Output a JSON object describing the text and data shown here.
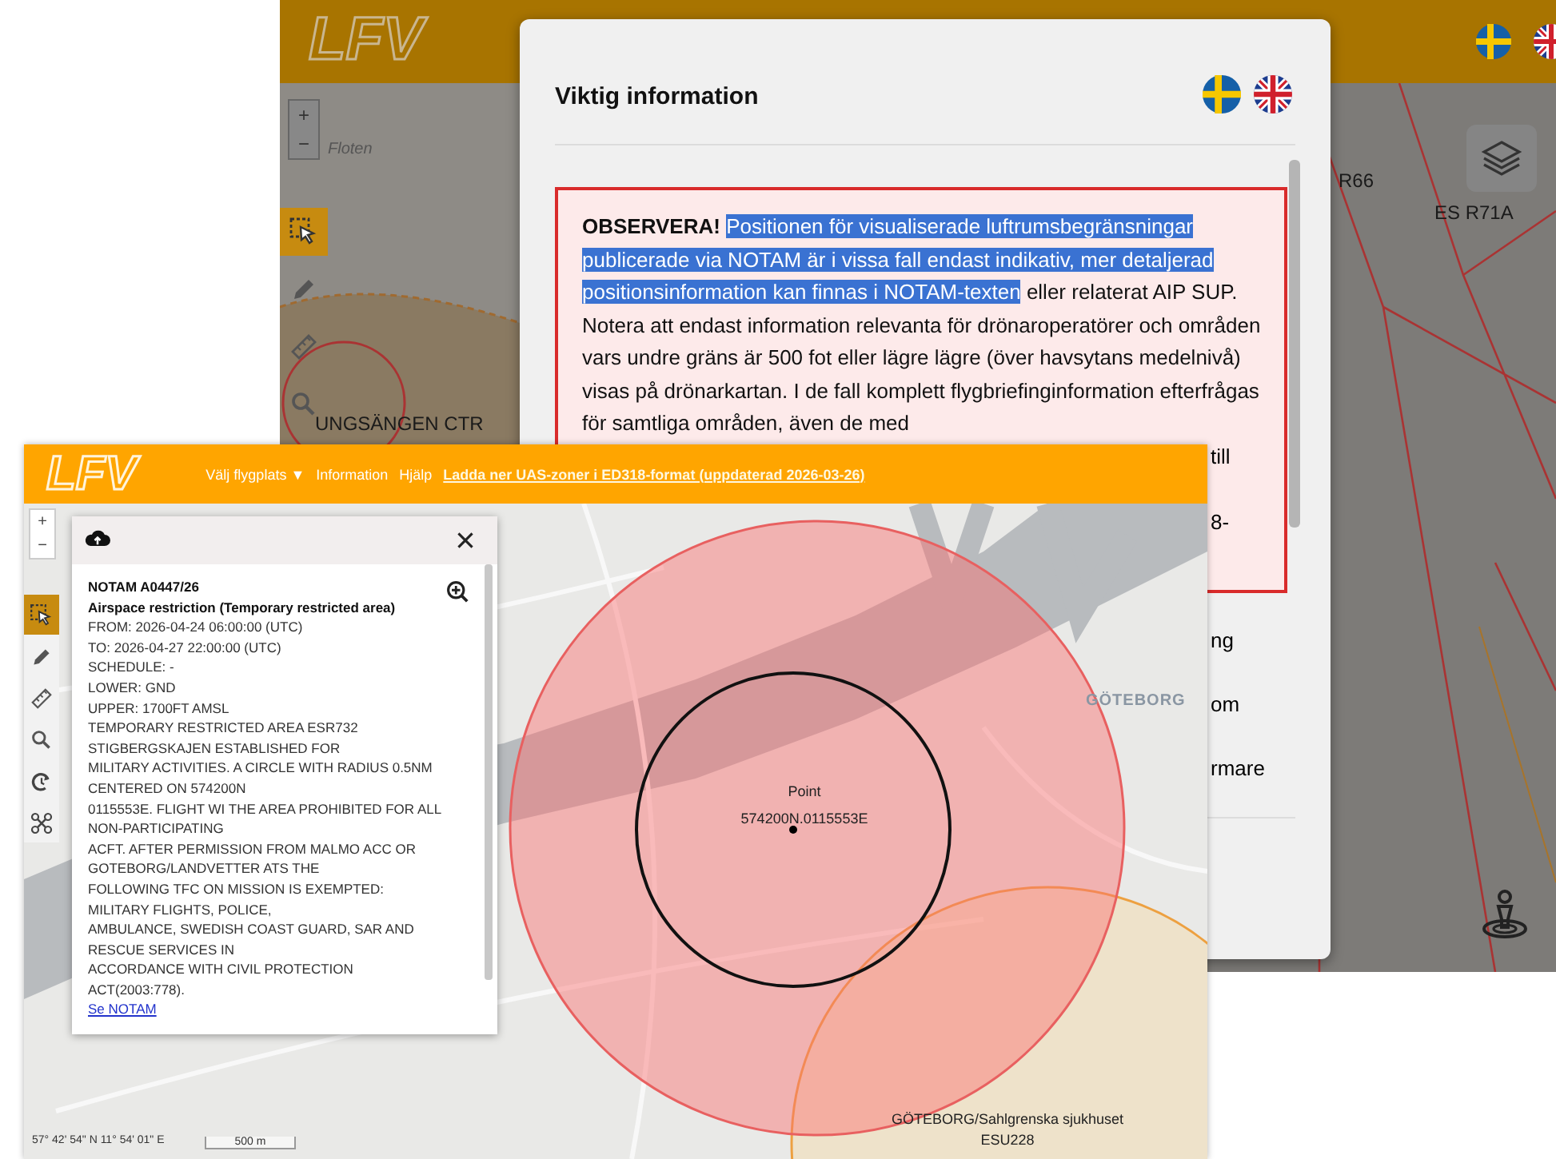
{
  "back_window": {
    "logo": "LFV",
    "zoom": [
      "+",
      "−"
    ],
    "tools": [
      {
        "kind": "select",
        "selected": true
      },
      {
        "kind": "pencil",
        "selected": false
      },
      {
        "kind": "ruler",
        "selected": false
      },
      {
        "kind": "search",
        "selected": false
      }
    ],
    "map_labels": [
      {
        "kind": "place",
        "text": "Floten"
      },
      {
        "kind": "zone",
        "text": "R66"
      },
      {
        "kind": "zone",
        "text": "ES R71A"
      },
      {
        "kind": "zone",
        "text": "UNGSÄNGEN CTR"
      }
    ]
  },
  "modal": {
    "title": "Viktig information",
    "notice": {
      "lead": "OBSERVERA!",
      "highlighted": "Positionen för visualiserade luftrumsbegränsningar publicerade via NOTAM är i vissa fall endast indikativ, mer detaljerad positionsinformation kan finnas i NOTAM-texten",
      "text": "eller relaterat AIP SUP. Notera att endast information relevanta för drönaroperatörer och områden vars undre gräns är 500 fot eller lägre lägre (över havsytans medelnivå) visas på drönarkartan. I de fall komplett flygbriefinginformation efterfrågas för samtliga områden, även de med"
    },
    "notice_fragments": [
      "till",
      "8-"
    ],
    "fragments": [
      "ng",
      "om",
      "rmare"
    ]
  },
  "front_window": {
    "logo": "LFV",
    "nav": [
      {
        "kind": "menu",
        "text": "Välj flygplats ▼"
      },
      {
        "kind": "menu",
        "text": "Information"
      },
      {
        "kind": "menu",
        "text": "Hjälp"
      },
      {
        "kind": "link",
        "text": "Ladda ner UAS-zoner i ED318-format (uppdaterad 2026-03-26)"
      }
    ],
    "zoom": [
      "+",
      "−"
    ],
    "tools": [
      {
        "kind": "select",
        "selected": true
      },
      {
        "kind": "pencil",
        "selected": false
      },
      {
        "kind": "ruler",
        "selected": false
      },
      {
        "kind": "search",
        "selected": false
      },
      {
        "kind": "timer",
        "selected": false
      },
      {
        "kind": "drone",
        "selected": false
      }
    ],
    "popup": {
      "lines": [
        {
          "kind": "heading",
          "text": "NOTAM A0447/26"
        },
        {
          "kind": "heading",
          "text": "Airspace restriction (Temporary restricted area)"
        },
        {
          "kind": "text",
          "text": "FROM: 2026-04-24 06:00:00 (UTC)"
        },
        {
          "kind": "text",
          "text": "TO: 2026-04-27 22:00:00 (UTC)"
        },
        {
          "kind": "text",
          "text": "SCHEDULE: -"
        },
        {
          "kind": "text",
          "text": "LOWER: GND"
        },
        {
          "kind": "text",
          "text": "UPPER: 1700FT AMSL"
        },
        {
          "kind": "text",
          "text": "TEMPORARY RESTRICTED AREA ESR732"
        },
        {
          "kind": "text",
          "text": "STIGBERGSKAJEN ESTABLISHED FOR"
        },
        {
          "kind": "text",
          "text": "MILITARY ACTIVITIES. A CIRCLE WITH RADIUS 0.5NM"
        },
        {
          "kind": "text",
          "text": "CENTERED ON 574200N"
        },
        {
          "kind": "text",
          "text": "0115553E. FLIGHT WI THE AREA PROHIBITED FOR ALL"
        },
        {
          "kind": "text",
          "text": "NON-PARTICIPATING"
        },
        {
          "kind": "text",
          "text": "ACFT. AFTER PERMISSION FROM MALMO ACC OR"
        },
        {
          "kind": "text",
          "text": "GOTEBORG/LANDVETTER ATS THE"
        },
        {
          "kind": "text",
          "text": "FOLLOWING TFC ON MISSION IS EXEMPTED:"
        },
        {
          "kind": "text",
          "text": "MILITARY FLIGHTS, POLICE,"
        },
        {
          "kind": "text",
          "text": "AMBULANCE, SWEDISH COAST GUARD, SAR AND"
        },
        {
          "kind": "text",
          "text": "RESCUE SERVICES IN"
        },
        {
          "kind": "text",
          "text": "ACCORDANCE WITH CIVIL PROTECTION"
        },
        {
          "kind": "text",
          "text": "ACT(2003:778)."
        },
        {
          "kind": "link",
          "text": "Se NOTAM"
        }
      ]
    },
    "map": {
      "point_label": "Point",
      "point_coords": "574200N.0115553E",
      "place_label": "GÖTEBORG",
      "zone_labels": [
        "GÖTEBORG/Sahlgrenska sjukhuset",
        "ESU228"
      ]
    },
    "coordinates": "57° 42' 54\" N 11° 54' 01\" E",
    "scale": "500 m"
  }
}
